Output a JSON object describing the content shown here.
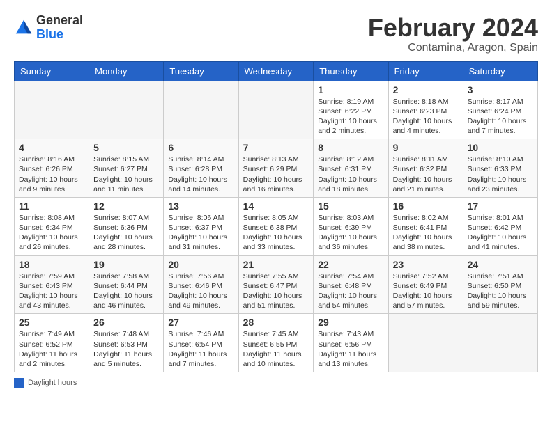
{
  "header": {
    "logo_general": "General",
    "logo_blue": "Blue",
    "month_title": "February 2024",
    "location": "Contamina, Aragon, Spain"
  },
  "weekdays": [
    "Sunday",
    "Monday",
    "Tuesday",
    "Wednesday",
    "Thursday",
    "Friday",
    "Saturday"
  ],
  "legend": {
    "label": "Daylight hours"
  },
  "weeks": [
    [
      {
        "day": "",
        "info": ""
      },
      {
        "day": "",
        "info": ""
      },
      {
        "day": "",
        "info": ""
      },
      {
        "day": "",
        "info": ""
      },
      {
        "day": "1",
        "info": "Sunrise: 8:19 AM\nSunset: 6:22 PM\nDaylight: 10 hours\nand 2 minutes."
      },
      {
        "day": "2",
        "info": "Sunrise: 8:18 AM\nSunset: 6:23 PM\nDaylight: 10 hours\nand 4 minutes."
      },
      {
        "day": "3",
        "info": "Sunrise: 8:17 AM\nSunset: 6:24 PM\nDaylight: 10 hours\nand 7 minutes."
      }
    ],
    [
      {
        "day": "4",
        "info": "Sunrise: 8:16 AM\nSunset: 6:26 PM\nDaylight: 10 hours\nand 9 minutes."
      },
      {
        "day": "5",
        "info": "Sunrise: 8:15 AM\nSunset: 6:27 PM\nDaylight: 10 hours\nand 11 minutes."
      },
      {
        "day": "6",
        "info": "Sunrise: 8:14 AM\nSunset: 6:28 PM\nDaylight: 10 hours\nand 14 minutes."
      },
      {
        "day": "7",
        "info": "Sunrise: 8:13 AM\nSunset: 6:29 PM\nDaylight: 10 hours\nand 16 minutes."
      },
      {
        "day": "8",
        "info": "Sunrise: 8:12 AM\nSunset: 6:31 PM\nDaylight: 10 hours\nand 18 minutes."
      },
      {
        "day": "9",
        "info": "Sunrise: 8:11 AM\nSunset: 6:32 PM\nDaylight: 10 hours\nand 21 minutes."
      },
      {
        "day": "10",
        "info": "Sunrise: 8:10 AM\nSunset: 6:33 PM\nDaylight: 10 hours\nand 23 minutes."
      }
    ],
    [
      {
        "day": "11",
        "info": "Sunrise: 8:08 AM\nSunset: 6:34 PM\nDaylight: 10 hours\nand 26 minutes."
      },
      {
        "day": "12",
        "info": "Sunrise: 8:07 AM\nSunset: 6:36 PM\nDaylight: 10 hours\nand 28 minutes."
      },
      {
        "day": "13",
        "info": "Sunrise: 8:06 AM\nSunset: 6:37 PM\nDaylight: 10 hours\nand 31 minutes."
      },
      {
        "day": "14",
        "info": "Sunrise: 8:05 AM\nSunset: 6:38 PM\nDaylight: 10 hours\nand 33 minutes."
      },
      {
        "day": "15",
        "info": "Sunrise: 8:03 AM\nSunset: 6:39 PM\nDaylight: 10 hours\nand 36 minutes."
      },
      {
        "day": "16",
        "info": "Sunrise: 8:02 AM\nSunset: 6:41 PM\nDaylight: 10 hours\nand 38 minutes."
      },
      {
        "day": "17",
        "info": "Sunrise: 8:01 AM\nSunset: 6:42 PM\nDaylight: 10 hours\nand 41 minutes."
      }
    ],
    [
      {
        "day": "18",
        "info": "Sunrise: 7:59 AM\nSunset: 6:43 PM\nDaylight: 10 hours\nand 43 minutes."
      },
      {
        "day": "19",
        "info": "Sunrise: 7:58 AM\nSunset: 6:44 PM\nDaylight: 10 hours\nand 46 minutes."
      },
      {
        "day": "20",
        "info": "Sunrise: 7:56 AM\nSunset: 6:46 PM\nDaylight: 10 hours\nand 49 minutes."
      },
      {
        "day": "21",
        "info": "Sunrise: 7:55 AM\nSunset: 6:47 PM\nDaylight: 10 hours\nand 51 minutes."
      },
      {
        "day": "22",
        "info": "Sunrise: 7:54 AM\nSunset: 6:48 PM\nDaylight: 10 hours\nand 54 minutes."
      },
      {
        "day": "23",
        "info": "Sunrise: 7:52 AM\nSunset: 6:49 PM\nDaylight: 10 hours\nand 57 minutes."
      },
      {
        "day": "24",
        "info": "Sunrise: 7:51 AM\nSunset: 6:50 PM\nDaylight: 10 hours\nand 59 minutes."
      }
    ],
    [
      {
        "day": "25",
        "info": "Sunrise: 7:49 AM\nSunset: 6:52 PM\nDaylight: 11 hours\nand 2 minutes."
      },
      {
        "day": "26",
        "info": "Sunrise: 7:48 AM\nSunset: 6:53 PM\nDaylight: 11 hours\nand 5 minutes."
      },
      {
        "day": "27",
        "info": "Sunrise: 7:46 AM\nSunset: 6:54 PM\nDaylight: 11 hours\nand 7 minutes."
      },
      {
        "day": "28",
        "info": "Sunrise: 7:45 AM\nSunset: 6:55 PM\nDaylight: 11 hours\nand 10 minutes."
      },
      {
        "day": "29",
        "info": "Sunrise: 7:43 AM\nSunset: 6:56 PM\nDaylight: 11 hours\nand 13 minutes."
      },
      {
        "day": "",
        "info": ""
      },
      {
        "day": "",
        "info": ""
      }
    ]
  ]
}
